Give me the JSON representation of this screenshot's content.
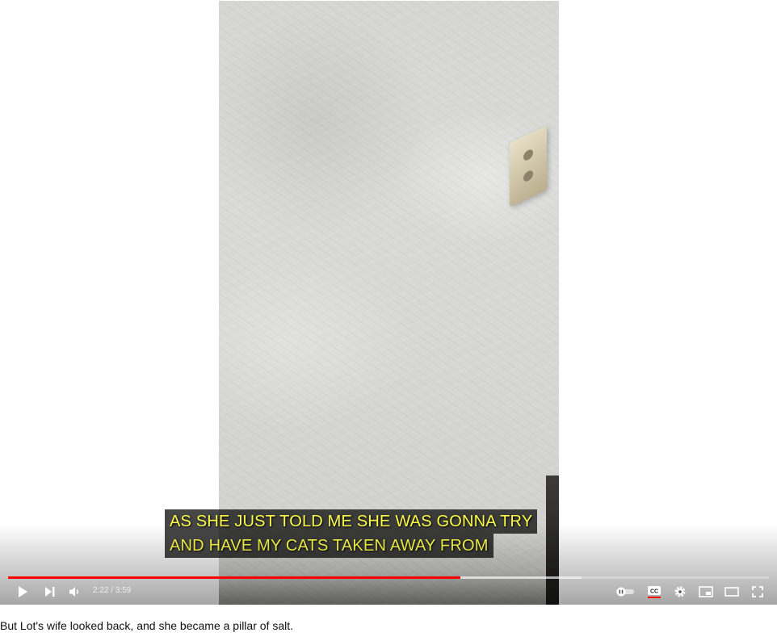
{
  "player": {
    "captions": [
      "AS SHE JUST TOLD ME SHE WAS GONNA TRY",
      "AND HAVE MY CATS TAKEN AWAY FROM"
    ],
    "time": {
      "current": "2:22",
      "separator": "/",
      "duration": "3:59"
    },
    "progress": {
      "played_fraction": 0.594,
      "buffered_fraction": 0.754
    },
    "colors": {
      "progress_played": "#ff0000",
      "caption_text": "#fcfc4a",
      "cc_indicator": "#ff0000"
    },
    "controls": {
      "left": [
        "play-icon",
        "next-icon",
        "volume-icon"
      ],
      "right": [
        "autoplay-toggle-icon",
        "cc-icon",
        "gear-icon",
        "miniplayer-icon",
        "theater-mode-icon",
        "fullscreen-icon"
      ]
    }
  },
  "description": {
    "text": "But Lot's wife looked back, and she became a pillar of salt."
  }
}
